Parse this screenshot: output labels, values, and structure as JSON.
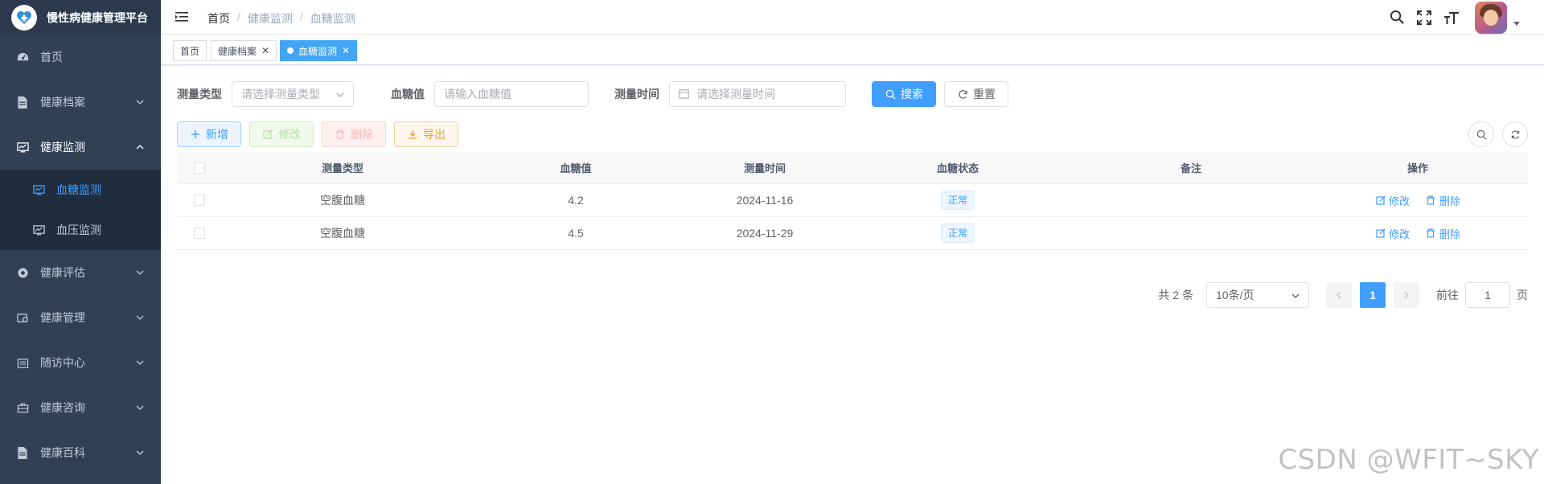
{
  "app": {
    "title": "慢性病健康管理平台"
  },
  "sidebar": {
    "items": [
      {
        "label": "首页",
        "icon": "dashboard-icon"
      },
      {
        "label": "健康档案",
        "icon": "document-icon"
      },
      {
        "label": "健康监测",
        "icon": "monitor-icon",
        "open": true,
        "children": [
          {
            "label": "血糖监测",
            "icon": "monitor-icon",
            "active": true
          },
          {
            "label": "血压监测",
            "icon": "monitor-icon"
          }
        ]
      },
      {
        "label": "健康评估",
        "icon": "lifebuoy-icon"
      },
      {
        "label": "健康管理",
        "icon": "gear-icon"
      },
      {
        "label": "随访中心",
        "icon": "calendar-icon"
      },
      {
        "label": "健康咨询",
        "icon": "briefcase-icon"
      },
      {
        "label": "健康百科",
        "icon": "document-icon"
      }
    ]
  },
  "navbar": {
    "breadcrumb": [
      "首页",
      "健康监测",
      "血糖监测"
    ]
  },
  "tags": [
    {
      "label": "首页"
    },
    {
      "label": "健康档案"
    },
    {
      "label": "血糖监测",
      "active": true
    }
  ],
  "search": {
    "type_label": "测量类型",
    "type_placeholder": "请选择测量类型",
    "value_label": "血糖值",
    "value_placeholder": "请输入血糖值",
    "time_label": "测量时间",
    "time_placeholder": "请选择测量时间",
    "search_btn": "搜索",
    "reset_btn": "重置"
  },
  "toolbar": {
    "add": "新增",
    "edit": "修改",
    "delete": "删除",
    "export": "导出"
  },
  "table": {
    "headers": [
      "测量类型",
      "血糖值",
      "测量时间",
      "血糖状态",
      "备注",
      "操作"
    ],
    "rows": [
      {
        "type": "空腹血糖",
        "value": "4.2",
        "time": "2024-11-16",
        "status": "正常",
        "note": "",
        "edit": "修改",
        "delete": "删除"
      },
      {
        "type": "空腹血糖",
        "value": "4.5",
        "time": "2024-11-29",
        "status": "正常",
        "note": "",
        "edit": "修改",
        "delete": "删除"
      }
    ]
  },
  "pagination": {
    "total": "共 2 条",
    "page_size": "10条/页",
    "current": "1",
    "goto_label": "前往",
    "goto_value": "1",
    "page_unit": "页"
  },
  "watermark": "CSDN @WFIT~SKY",
  "colors": {
    "sidebar_bg": "#304156",
    "accent": "#409eff"
  }
}
